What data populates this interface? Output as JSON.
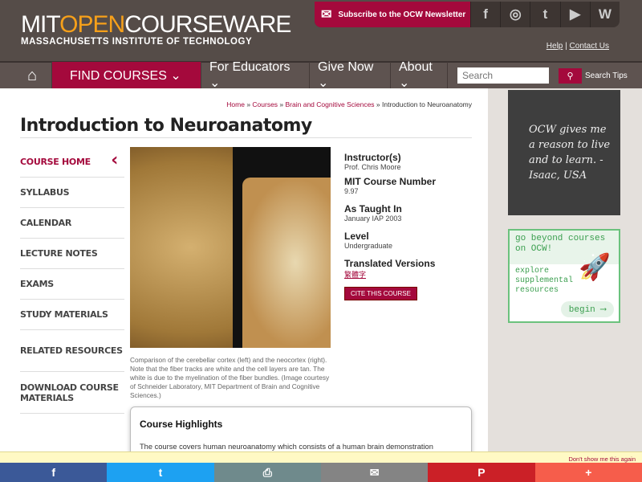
{
  "header": {
    "logo_mit": "MIT",
    "logo_open": "OPEN",
    "logo_cw": "COURSEWARE",
    "logo_sub": "MASSACHUSETTS INSTITUTE OF TECHNOLOGY",
    "subscribe": "Subscribe to the OCW Newsletter",
    "help": "Help",
    "contact": "Contact Us",
    "social": [
      "f",
      "◎",
      "t",
      "▶",
      "W"
    ]
  },
  "nav": {
    "find": "FIND COURSES ⌄",
    "educators": "For Educators ⌄",
    "give": "Give Now ⌄",
    "about": "About ⌄",
    "search_placeholder": "Search",
    "search_tips": "Search Tips"
  },
  "breadcrumb": {
    "home": "Home",
    "courses": "Courses",
    "dept": "Brain and Cognitive Sciences",
    "current": "Introduction to Neuroanatomy"
  },
  "title": "Introduction to Neuroanatomy",
  "sidebar": [
    "COURSE HOME",
    "SYLLABUS",
    "CALENDAR",
    "LECTURE NOTES",
    "EXAMS",
    "STUDY MATERIALS",
    "RELATED RESOURCES",
    "DOWNLOAD COURSE MATERIALS"
  ],
  "caption": "Comparison of the cerebellar cortex (left) and the neocortex (right). Note that the fiber tracks are white and the cell layers are tan. The white is due to the myelination of the fiber bundles. (Image courtesy of Schneider Laboratory, MIT Department of Brain and Cognitive Sciences.)",
  "info": {
    "instructor_label": "Instructor(s)",
    "instructor": "Prof. Chris Moore",
    "number_label": "MIT Course Number",
    "number": "9.97",
    "taught_label": "As Taught In",
    "taught": "January IAP 2003",
    "level_label": "Level",
    "level": "Undergraduate",
    "translated_label": "Translated Versions",
    "translated": "繁體字",
    "cite": "CITE THIS COURSE"
  },
  "highlights": {
    "title": "Course Highlights",
    "text": "The course covers human neuroanatomy which consists of a human brain demonstration"
  },
  "quote": "OCW gives me a reason to live and to learn. - Isaac, USA",
  "beyond": {
    "title": "go beyond courses on OCW!",
    "text": "explore supplemental resources",
    "begin": "begin ⟶"
  },
  "banner": {
    "dismiss": "Don't show me this again"
  },
  "share": [
    {
      "icon": "f",
      "color": "#3b5998"
    },
    {
      "icon": "t",
      "color": "#1da1f2"
    },
    {
      "icon": "⎙",
      "color": "#6f8a8c"
    },
    {
      "icon": "✉",
      "color": "#848484"
    },
    {
      "icon": "P",
      "color": "#cb2027"
    },
    {
      "icon": "+",
      "color": "#f65d4b"
    }
  ]
}
